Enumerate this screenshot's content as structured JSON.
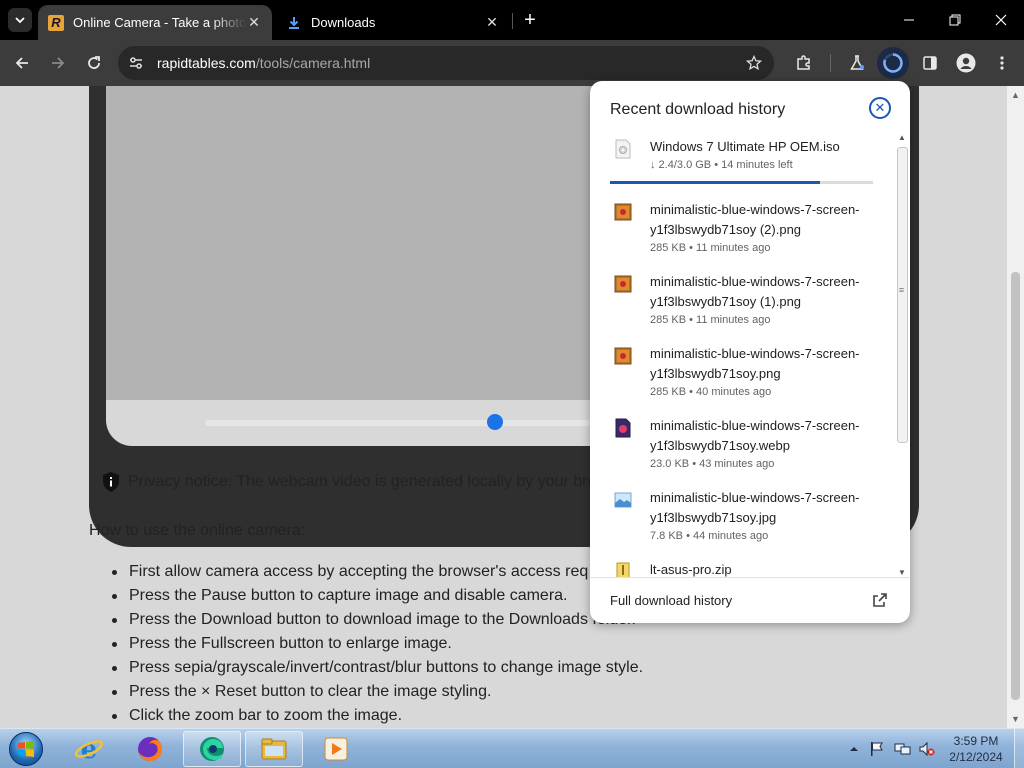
{
  "browser": {
    "tabs": [
      {
        "title": "Online Camera - Take a photo",
        "icon": "rapidtables-favicon",
        "active": true
      },
      {
        "title": "Downloads",
        "icon": "download-icon",
        "active": false
      }
    ],
    "url": {
      "host": "rapidtables.com",
      "path": "/tools/camera.html"
    }
  },
  "page": {
    "privacy_notice": "Privacy notice: The webcam video is generated locally by your bro",
    "howto_heading": "How to use the online camera:",
    "steps": [
      "First allow camera access by accepting the browser's access req",
      "Press the Pause button to capture image and disable camera.",
      "Press the Download button to download image to the Downloads folder.",
      "Press the Fullscreen button to enlarge image.",
      "Press sepia/grayscale/invert/contrast/blur buttons to change image style.",
      "Press the × Reset button to clear the image styling.",
      "Click the zoom bar to zoom the image."
    ],
    "zoom_level": 0.75
  },
  "downloads": {
    "title": "Recent download history",
    "items": [
      {
        "name": "Windows 7 Ultimate HP OEM.iso",
        "meta": "↓ 2.4/3.0 GB • 14 minutes left",
        "icon": "iso-file-icon",
        "progress": 0.8
      },
      {
        "name": "minimalistic-blue-windows-7-screen-y1f3lbswydb71soy (2).png",
        "meta": "285 KB • 11 minutes ago",
        "icon": "png-file-icon"
      },
      {
        "name": "minimalistic-blue-windows-7-screen-y1f3lbswydb71soy (1).png",
        "meta": "285 KB • 11 minutes ago",
        "icon": "png-file-icon"
      },
      {
        "name": "minimalistic-blue-windows-7-screen-y1f3lbswydb71soy.png",
        "meta": "285 KB • 40 minutes ago",
        "icon": "png-file-icon"
      },
      {
        "name": "minimalistic-blue-windows-7-screen-y1f3lbswydb71soy.webp",
        "meta": "23.0 KB • 43 minutes ago",
        "icon": "webp-file-icon"
      },
      {
        "name": "minimalistic-blue-windows-7-screen-y1f3lbswydb71soy.jpg",
        "meta": "7.8 KB • 44 minutes ago",
        "icon": "jpg-file-icon"
      },
      {
        "name": "lt-asus-pro.zip",
        "meta": "",
        "icon": "zip-file-icon"
      }
    ],
    "footer_link": "Full download history"
  },
  "taskbar": {
    "apps": [
      "internet-explorer-icon",
      "firefox-icon",
      "edge-icon",
      "file-explorer-icon",
      "media-player-icon"
    ],
    "clock": {
      "time": "3:59 PM",
      "date": "2/12/2024"
    }
  },
  "colors": {
    "accent": "#1a57b8",
    "tab_active": "#3c3c3c",
    "toolbar": "#3c3c3c",
    "page_bg": "#d8d8d8",
    "zoom_knob": "#1a73e8"
  }
}
